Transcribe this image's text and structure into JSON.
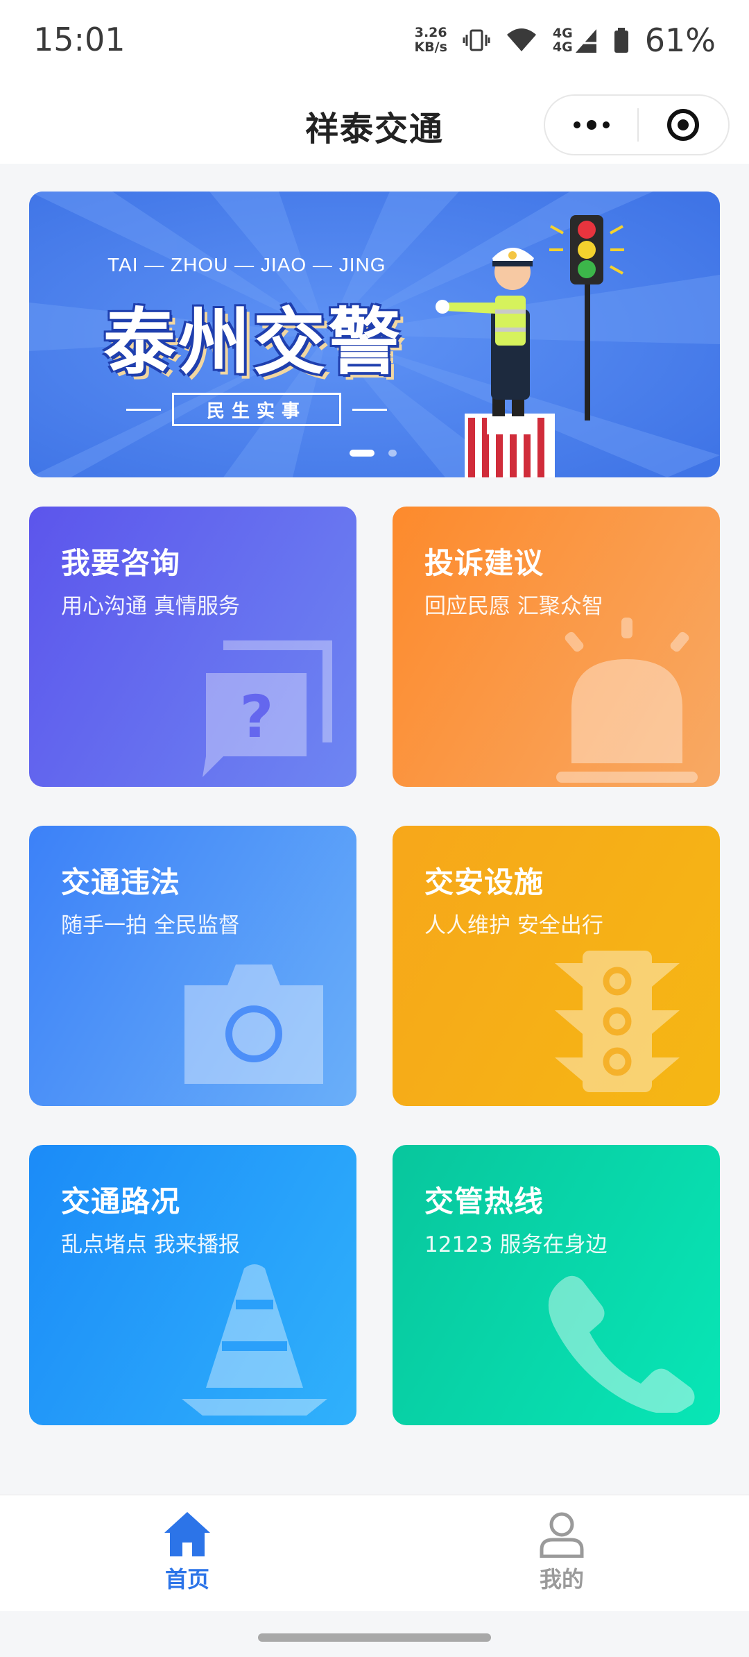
{
  "status_bar": {
    "time": "15:01",
    "net_speed_value": "3.26",
    "net_speed_unit": "KB/s",
    "network_type_1": "4G",
    "network_type_2": "4G",
    "battery_percent": "61%"
  },
  "title_bar": {
    "title": "祥泰交通",
    "icons": [
      "more-icon",
      "close-miniprogram-icon"
    ]
  },
  "banner": {
    "subtitle_en": "TAI — ZHOU — JIAO — JING",
    "title_cn": "泰州交警",
    "badge": "民生实事",
    "slide_count": 2,
    "active_slide": 1,
    "colors": {
      "background": "#4c82ee",
      "badge_border": "#ffffff"
    }
  },
  "cards": [
    {
      "title": "我要咨询",
      "subtitle": "用心沟通 真情服务",
      "icon": "chat-question-icon",
      "colors": [
        "#5c55ec",
        "#6e86f2"
      ]
    },
    {
      "title": "投诉建议",
      "subtitle": "回应民愿 汇聚众智",
      "icon": "alarm-light-icon",
      "colors": [
        "#fd8a2c",
        "#f8a964"
      ]
    },
    {
      "title": "交通违法",
      "subtitle": "随手一拍 全民监督",
      "icon": "camera-icon",
      "colors": [
        "#3c81f8",
        "#6aaff9"
      ]
    },
    {
      "title": "交安设施",
      "subtitle": "人人维护 安全出行",
      "icon": "traffic-light-icon",
      "colors": [
        "#f7a71a",
        "#f5b714"
      ]
    },
    {
      "title": "交通路况",
      "subtitle": "乱点堵点 我来播报",
      "icon": "traffic-cone-icon",
      "colors": [
        "#1b8bf8",
        "#30b1fb"
      ]
    },
    {
      "title": "交管热线",
      "subtitle": "12123 服务在身边",
      "icon": "phone-icon",
      "colors": [
        "#08c69d",
        "#08e6b6"
      ]
    }
  ],
  "tab_bar": {
    "tabs": [
      {
        "label": "首页",
        "icon": "home-icon",
        "active": true
      },
      {
        "label": "我的",
        "icon": "user-icon",
        "active": false
      }
    ],
    "colors": {
      "active": "#2c74e8",
      "inactive": "#9a9a9a"
    }
  }
}
